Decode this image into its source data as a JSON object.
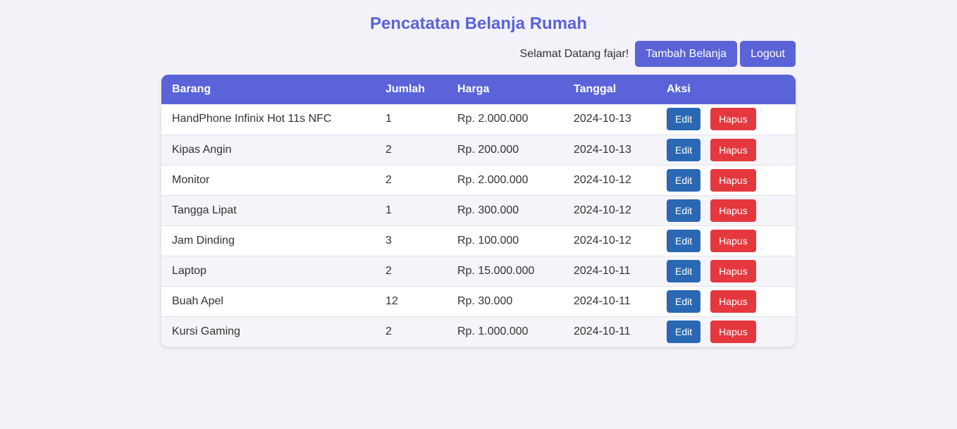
{
  "header": {
    "title": "Pencatatan Belanja Rumah",
    "welcome": "Selamat Datang fajar!",
    "add_label": "Tambah Belanja",
    "logout_label": "Logout"
  },
  "colors": {
    "accent": "#5a63d8",
    "edit": "#2a68b3",
    "delete": "#e5383e"
  },
  "table": {
    "columns": [
      "Barang",
      "Jumlah",
      "Harga",
      "Tanggal",
      "Aksi"
    ],
    "edit_label": "Edit",
    "delete_label": "Hapus",
    "rows": [
      {
        "barang": "HandPhone Infinix Hot 11s NFC",
        "jumlah": "1",
        "harga": "Rp. 2.000.000",
        "tanggal": "2024-10-13"
      },
      {
        "barang": "Kipas Angin",
        "jumlah": "2",
        "harga": "Rp. 200.000",
        "tanggal": "2024-10-13"
      },
      {
        "barang": "Monitor",
        "jumlah": "2",
        "harga": "Rp. 2.000.000",
        "tanggal": "2024-10-12"
      },
      {
        "barang": "Tangga Lipat",
        "jumlah": "1",
        "harga": "Rp. 300.000",
        "tanggal": "2024-10-12"
      },
      {
        "barang": "Jam Dinding",
        "jumlah": "3",
        "harga": "Rp. 100.000",
        "tanggal": "2024-10-12"
      },
      {
        "barang": "Laptop",
        "jumlah": "2",
        "harga": "Rp. 15.000.000",
        "tanggal": "2024-10-11"
      },
      {
        "barang": "Buah Apel",
        "jumlah": "12",
        "harga": "Rp. 30.000",
        "tanggal": "2024-10-11"
      },
      {
        "barang": "Kursi Gaming",
        "jumlah": "2",
        "harga": "Rp. 1.000.000",
        "tanggal": "2024-10-11"
      }
    ]
  }
}
